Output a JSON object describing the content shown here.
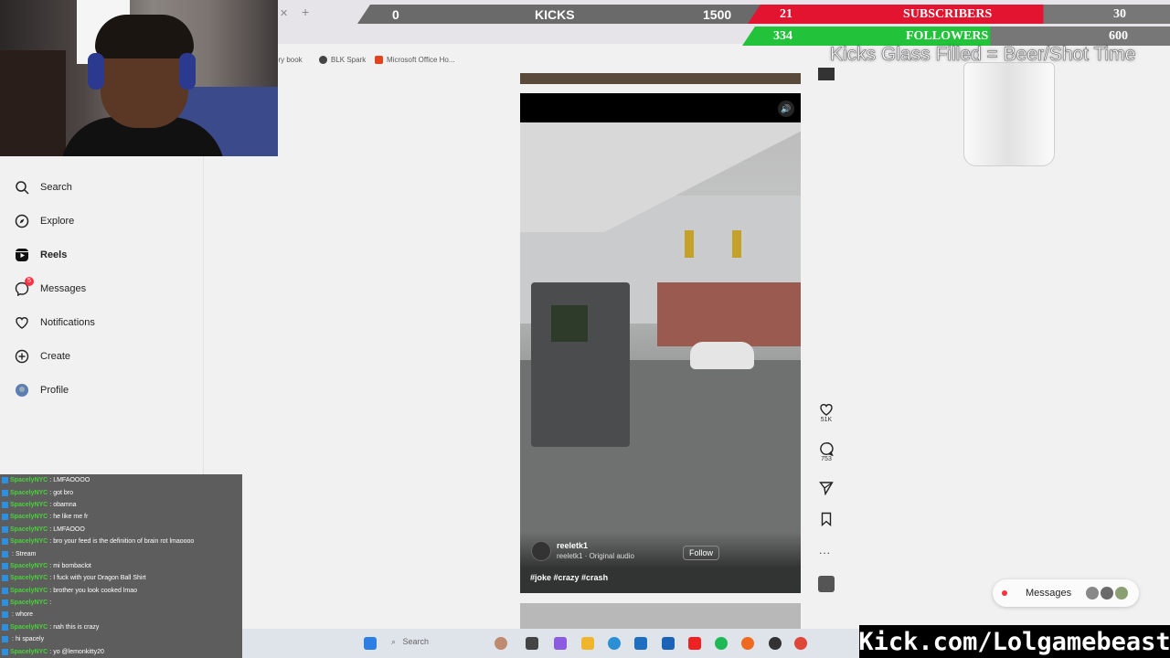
{
  "bookmarks": [
    {
      "label": "ory book",
      "color": "#7a7a7a"
    },
    {
      "label": "BLK Spark",
      "color": "#444444"
    },
    {
      "label": "Microsoft Office Ho...",
      "color": "#e2421e"
    }
  ],
  "sidebar": {
    "items": [
      {
        "label": "Search",
        "icon": "search-icon"
      },
      {
        "label": "Explore",
        "icon": "compass-icon"
      },
      {
        "label": "Reels",
        "icon": "reels-icon",
        "active": true
      },
      {
        "label": "Messages",
        "icon": "messenger-icon",
        "badge": "5"
      },
      {
        "label": "Notifications",
        "icon": "heart-icon"
      },
      {
        "label": "Create",
        "icon": "plus-square-icon"
      },
      {
        "label": "Profile",
        "icon": "avatar-icon"
      }
    ]
  },
  "reel": {
    "username": "reeletk1",
    "audio": "reeletk1 · Original audio",
    "follow_label": "Follow",
    "caption": "#joke #crazy #crash",
    "likes": "51K",
    "comments": "753",
    "more": "..."
  },
  "messages_pill": {
    "label": "Messages",
    "badge": "5"
  },
  "taskbar": {
    "search_placeholder": "Search"
  },
  "overlays": {
    "kicks": {
      "current": "0",
      "label": "KICKS",
      "goal": "1500"
    },
    "subscribers": {
      "current": "21",
      "label": "SUBSCRIBERS",
      "goal": "30",
      "progress": 0.7
    },
    "followers": {
      "current": "334",
      "label": "FOLLOWERS",
      "goal": "600",
      "progress": 0.56
    },
    "glass_text": "Kicks Glass Filled = Beer/Shot Time",
    "kick_url": "Kick.com/Lolgamebeast"
  },
  "chat": [
    {
      "user": "SpacelyNYC",
      "msg": "LMFAOOOO"
    },
    {
      "user": "SpacelyNYC",
      "msg": "got bro"
    },
    {
      "user": "SpacelyNYC",
      "msg": "obamna"
    },
    {
      "user": "SpacelyNYC",
      "msg": "he like me fr"
    },
    {
      "user": "SpacelyNYC",
      "msg": "LMFAOOO"
    },
    {
      "user": "SpacelyNYC",
      "msg": "bro your feed is the definition of brain rot lmaoooo"
    },
    {
      "user": "",
      "msg": "Stream"
    },
    {
      "user": "SpacelyNYC",
      "msg": "mi bombaclot"
    },
    {
      "user": "SpacelyNYC",
      "msg": "I fuck with your Dragon Ball Shirt"
    },
    {
      "user": "SpacelyNYC",
      "msg": "brother you look cooked lmao"
    },
    {
      "user": "SpacelyNYC",
      "msg": ""
    },
    {
      "user": "",
      "msg": "whore"
    },
    {
      "user": "SpacelyNYC",
      "msg": "nah this is crazy"
    },
    {
      "user": "",
      "msg": "hi spacely"
    },
    {
      "user": "SpacelyNYC",
      "msg": "yo @lemonkitty20"
    }
  ],
  "colors": {
    "subs": "#e2142f",
    "follows": "#22c23b",
    "accent_badge": "#ff3040"
  }
}
